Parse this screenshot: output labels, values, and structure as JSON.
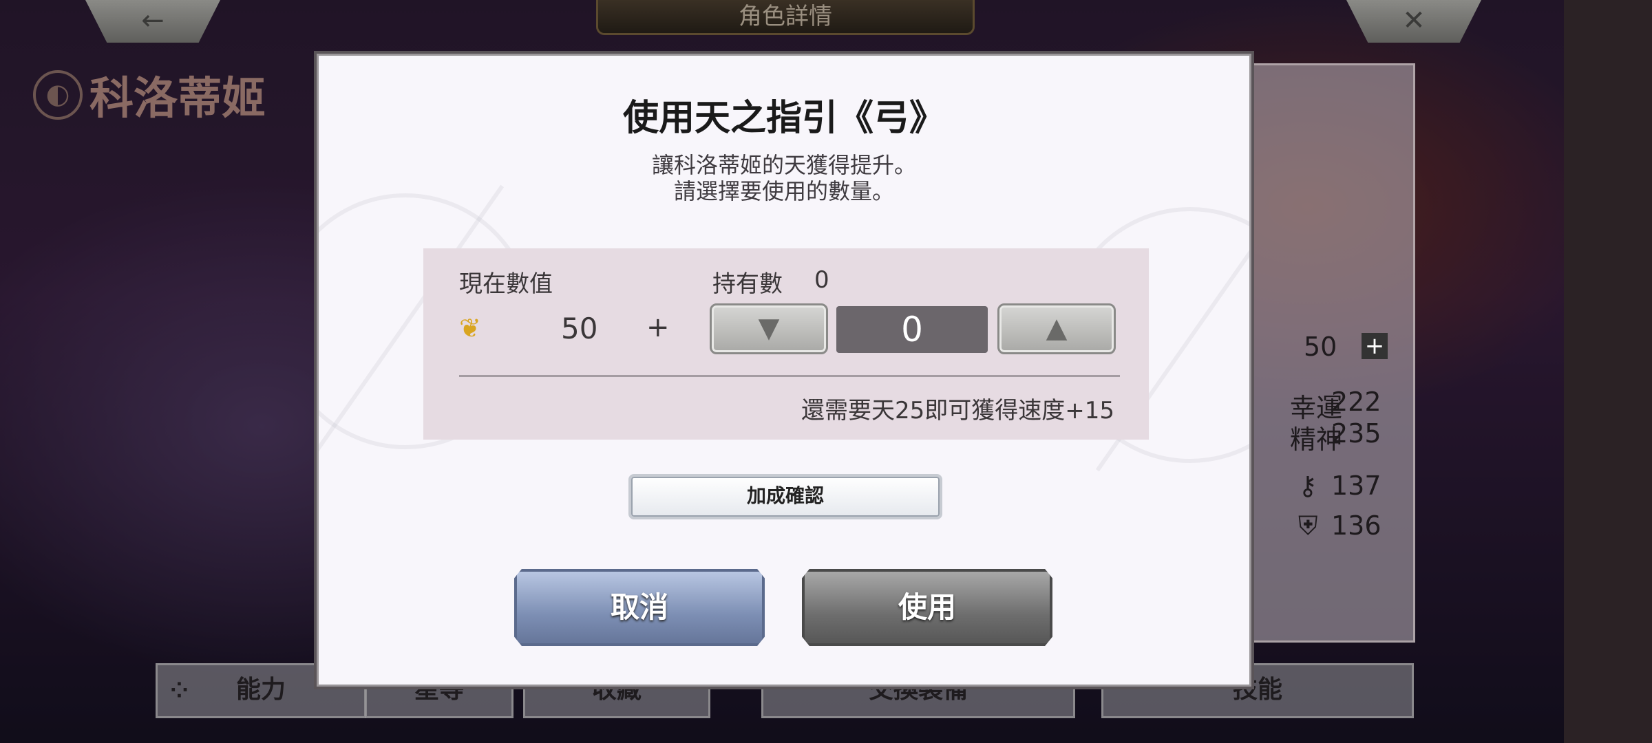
{
  "top_bar": {
    "back_icon": "←",
    "title": "角色詳情",
    "close_icon": "✕"
  },
  "character": {
    "name": "科洛蒂姬"
  },
  "side_stats": {
    "stat_value": "50",
    "luck_label": "幸運",
    "luck_value": "222",
    "spirit_label": "精神",
    "spirit_value": "235",
    "key_value": "137",
    "shield_value": "136"
  },
  "bottom_tabs": [
    "能力",
    "星等",
    "收藏",
    "交換裝備",
    "技能"
  ],
  "modal": {
    "title": "使用天之指引《弓》",
    "desc_line1": "讓科洛蒂姬的天獲得提升。",
    "desc_line2": "請選擇要使用的數量。",
    "current_label": "現在數值",
    "owned_label": "持有數",
    "owned_count": "0",
    "current_value": "50",
    "plus_sign": "+",
    "quantity": "0",
    "down_icon": "▼",
    "up_icon": "▲",
    "need_text": "還需要天25即可獲得速度+15",
    "confirm_label": "加成確認",
    "cancel_label": "取消",
    "use_label": "使用"
  },
  "colors": {
    "modal_bg": "#f8f6fb",
    "panel_bg": "#e6dbe2",
    "wing_icon": "#d9a520",
    "quantity_box": "#6b666b"
  }
}
